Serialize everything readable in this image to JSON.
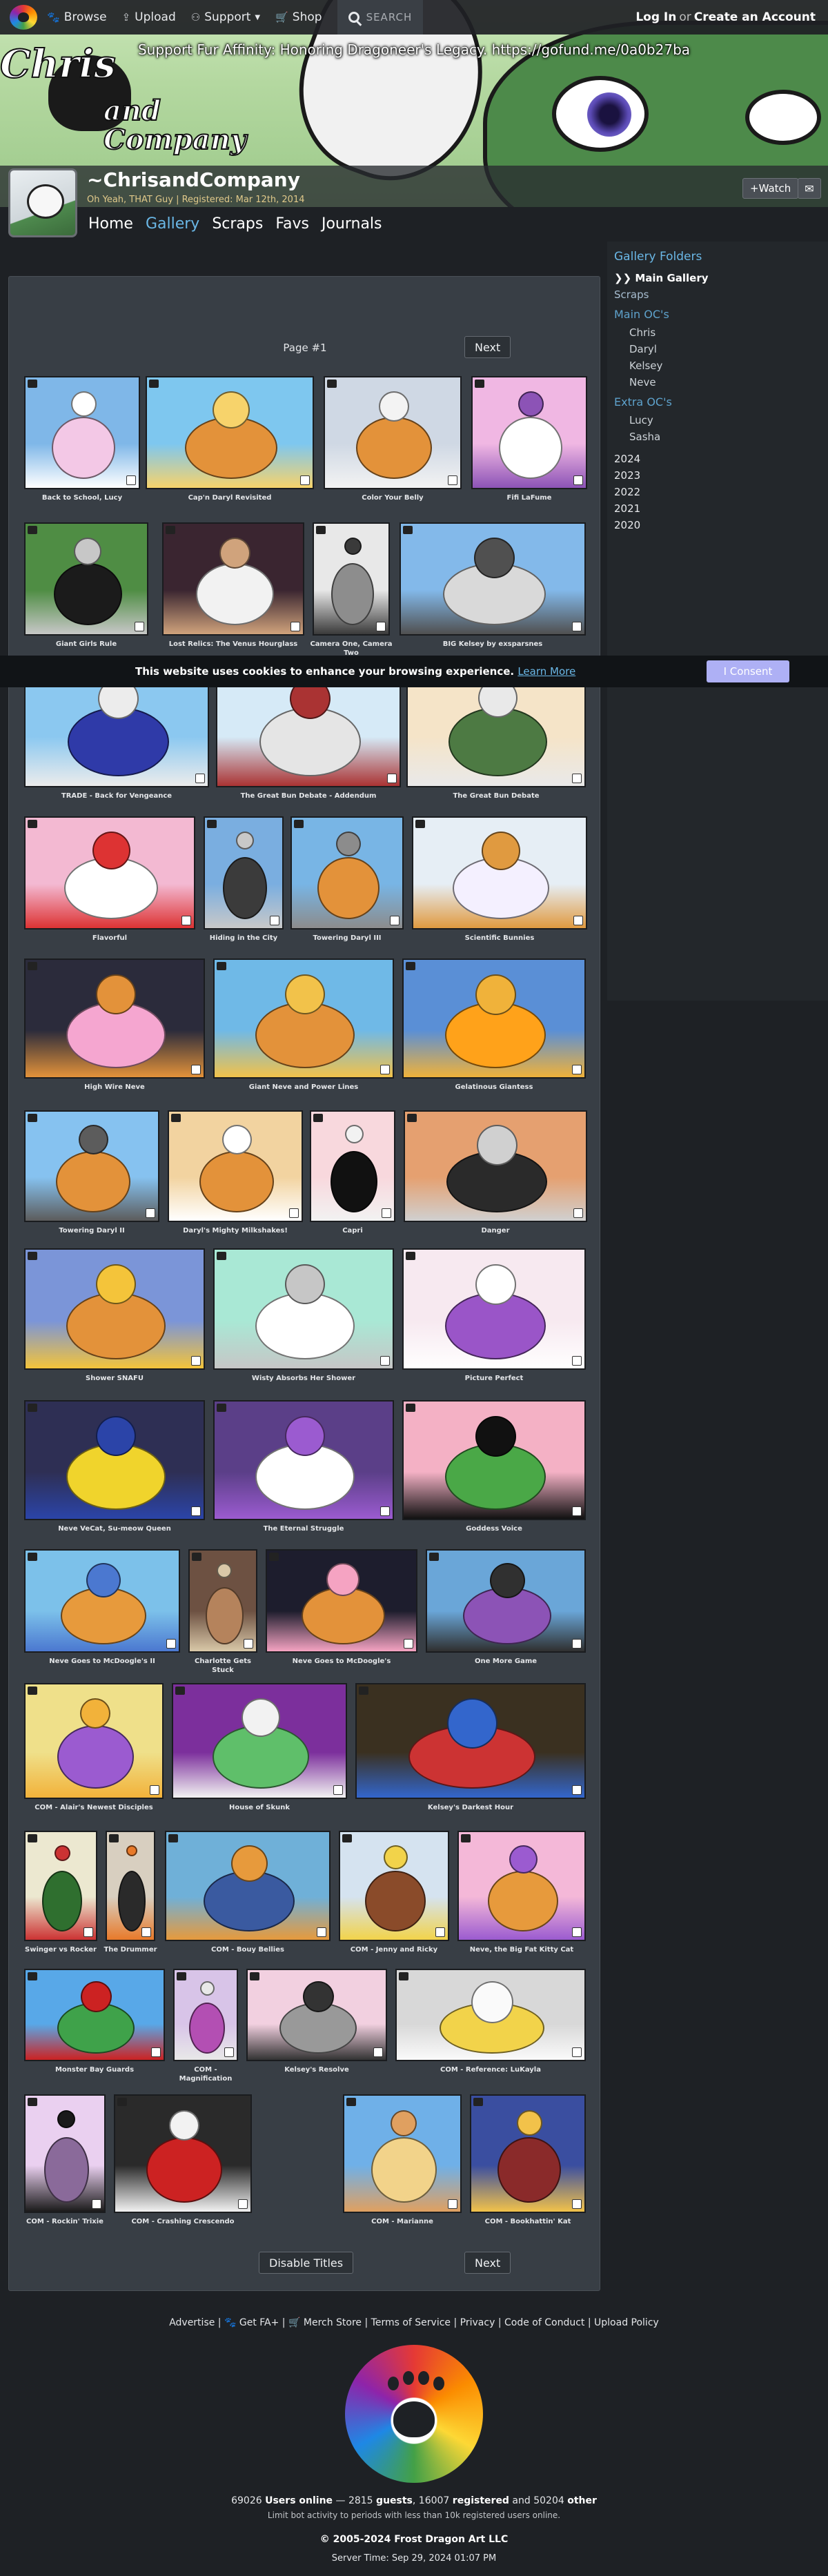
{
  "topnav": {
    "browse": "Browse",
    "upload": "Upload",
    "support": "Support",
    "shop": "Shop",
    "search_placeholder": "SEARCH",
    "login": "Log In",
    "or": "or",
    "create": "Create an Account"
  },
  "banner": {
    "announcement": "Support Fur Affinity: Honoring Dragoneer's Legacy. https://gofund.me/0a0b27ba",
    "logo_line1": "Chris",
    "logo_line2": "and",
    "logo_line3": "Company"
  },
  "profile": {
    "username": "~ChrisandCompany",
    "status": "Oh Yeah, THAT Guy | Registered: Mar 12th, 2014",
    "watch_label": "+Watch",
    "note_icon": "envelope-icon"
  },
  "subnav": [
    "Home",
    "Gallery",
    "Scraps",
    "Favs",
    "Journals"
  ],
  "sidebar": {
    "title": "Gallery Folders",
    "main_gallery": "❯❯ Main Gallery",
    "scraps": "Scraps",
    "main_ocs_title": "Main OC's",
    "main_ocs": [
      "Chris",
      "Daryl",
      "Kelsey",
      "Neve"
    ],
    "extra_ocs_title": "Extra OC's",
    "extra_ocs": [
      "Lucy",
      "Sasha"
    ],
    "years": [
      "2024",
      "2023",
      "2022",
      "2021",
      "2020"
    ]
  },
  "gallery": {
    "page_label": "Page #1",
    "next_label": "Next",
    "disable_titles_label": "Disable Titles",
    "items": [
      "Back to School, Lucy",
      "Cap'n Daryl Revisited",
      "Color Your Belly",
      "Fifi LaFume",
      "Giant Girls Rule",
      "Lost Relics: The Venus Hourglass",
      "Camera One, Camera Two",
      "BIG Kelsey by exsparsnes",
      "TRADE - Back for Vengeance",
      "The Great Bun Debate - Addendum",
      "The Great Bun Debate",
      "Flavorful",
      "Hiding in the City",
      "Towering Daryl III",
      "Scientific Bunnies",
      "High Wire Neve",
      "Giant Neve and Power Lines",
      "Gelatinous Giantess",
      "Towering Daryl II",
      "Daryl's Mighty Milkshakes!",
      "Capri",
      "Danger",
      "Shower SNAFU",
      "Wisty Absorbs Her Shower",
      "Picture Perfect",
      "Neve VeCat, Su-meow Queen",
      "The Eternal Struggle",
      "Goddess Voice",
      "Neve Goes to McDoogle's II",
      "Charlotte Gets Stuck",
      "Neve Goes to McDoogle's",
      "One More Game",
      "COM - Alair's Newest Disciples",
      "House of Skunk",
      "Kelsey's Darkest Hour",
      "Swinger vs Rocker",
      "The Drummer",
      "COM - Bouy Bellies",
      "COM - Jenny and Ricky",
      "Neve, the Big Fat Kitty Cat",
      "Monster Bay Guards",
      "COM - Magnification",
      "Kelsey's Resolve",
      "COM - Reference: LuKayla",
      "COM - Rockin' Trixie",
      "COM - Crashing Crescendo",
      "COM - Marianne",
      "COM - Bookhattin' Kat"
    ]
  },
  "cookie": {
    "message": "This website uses cookies to enhance your browsing experience.",
    "learn_more": "Learn More",
    "consent": "I Consent"
  },
  "footer": {
    "links": [
      "Advertise",
      "Get FA+",
      "Merch Store",
      "Terms of Service",
      "Privacy",
      "Code of Conduct",
      "Upload Policy"
    ],
    "users_online_count": "69026",
    "users_online_label": "Users online",
    "guests_count": "2815",
    "guests_label": "guests",
    "registered_count": "16007",
    "registered_label": "registered",
    "other_count": "50204",
    "other_label": "other",
    "limit_text": "Limit bot activity to periods with less than 10k registered users online.",
    "copyright": "© 2005-2024 Frost Dragon Art LLC",
    "server_time": "Server Time: Sep 29, 2024 01:07 PM"
  },
  "colors": {
    "accent": "#6ab7e6",
    "panel": "#383e45",
    "background": "#1e2125",
    "consent": "#aeb0f5"
  }
}
